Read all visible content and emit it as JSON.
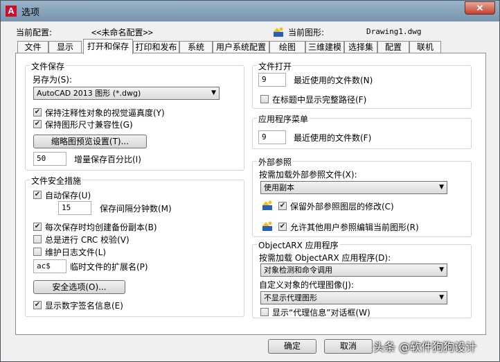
{
  "window": {
    "title": "选项",
    "close_glyph": "✕"
  },
  "header": {
    "profile_label": "当前配置:",
    "profile_value": "<<未命名配置>>",
    "drawing_label": "当前图形:",
    "drawing_value": "Drawing1.dwg"
  },
  "tabs": [
    "文件",
    "显示",
    "打开和保存",
    "打印和发布",
    "系统",
    "用户系统配置",
    "绘图",
    "三维建模",
    "选择集",
    "配置",
    "联机"
  ],
  "file_save": {
    "title": "文件保存",
    "save_as_label": "另存为(S):",
    "save_as_value": "AutoCAD 2013 图形 (*.dwg)",
    "keep_annotative": {
      "label": "保持注释性对象的视觉逼真度(Y)",
      "checked": true
    },
    "keep_size_compat": {
      "label": "保持图形尺寸兼容性(G)",
      "checked": true
    },
    "thumbnail_button": "缩略图预览设置(T)...",
    "incremental_value": "50",
    "incremental_label": "增量保存百分比(I)"
  },
  "file_safety": {
    "title": "文件安全措施",
    "autosave": {
      "label": "自动保存(U)",
      "checked": true
    },
    "interval_value": "15",
    "interval_label": "保存间隔分钟数(M)",
    "backup": {
      "label": "每次保存时均创建备份副本(B)",
      "checked": true
    },
    "crc": {
      "label": "总是进行 CRC 校验(V)",
      "checked": false
    },
    "log": {
      "label": "维护日志文件(L)",
      "checked": false
    },
    "temp_ext_value": "ac$",
    "temp_ext_label": "临时文件的扩展名(P)",
    "security_button": "安全选项(O)...",
    "digital_sig": {
      "label": "显示数字签名信息(E)",
      "checked": true
    }
  },
  "file_open": {
    "title": "文件打开",
    "recent_value": "9",
    "recent_label": "最近使用的文件数(N)",
    "full_path": {
      "label": "在标题中显示完整路径(F)",
      "checked": false
    }
  },
  "app_menu": {
    "title": "应用程序菜单",
    "recent_value": "9",
    "recent_label": "最近使用的文件数(F)"
  },
  "xref": {
    "title": "外部参照",
    "demand_label": "按需加载外部参照文件(X):",
    "demand_value": "使用副本",
    "retain_layer": {
      "label": "保留外部参照图层的修改(C)",
      "checked": true
    },
    "allow_edit": {
      "label": "允许其他用户参照编辑当前图形(R)",
      "checked": true
    }
  },
  "objectarx": {
    "title": "ObjectARX 应用程序",
    "demand_label": "按需加载 ObjectARX 应用程序(D):",
    "demand_value": "对象检测和命令调用",
    "proxy_label": "自定义对象的代理图像(J):",
    "proxy_value": "不显示代理图形",
    "proxy_dialog": {
      "label": "显示“代理信息”对话框(W)",
      "checked": false
    }
  },
  "footer": {
    "ok": "确定",
    "cancel": "取消"
  },
  "watermark": "头条 @软件狗狗设计",
  "icons": {
    "check": "✔",
    "dropdown": "▼",
    "app_logo": "A"
  }
}
